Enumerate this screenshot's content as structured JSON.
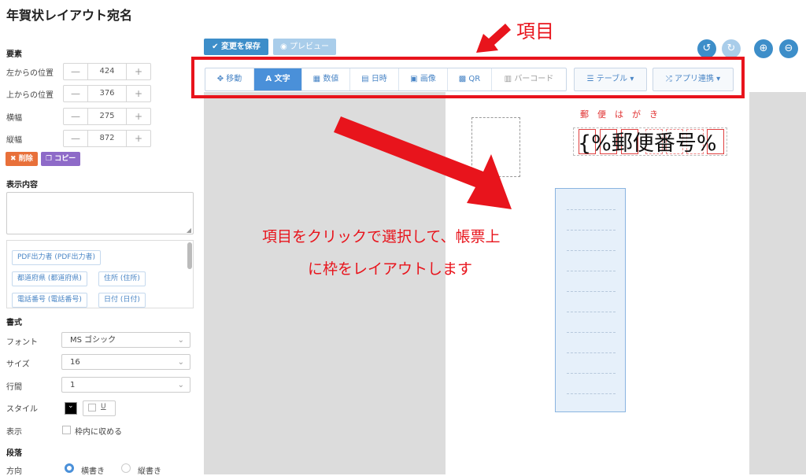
{
  "page": {
    "title": "年賀状レイアウト宛名"
  },
  "element_section": {
    "title": "要素",
    "fields": [
      {
        "label": "左からの位置",
        "value": "424"
      },
      {
        "label": "上からの位置",
        "value": "376"
      },
      {
        "label": "横幅",
        "value": "275"
      },
      {
        "label": "縦幅",
        "value": "872"
      }
    ],
    "minus": "—",
    "plus": "+",
    "delete_label": "削除",
    "copy_label": "コピー"
  },
  "content_section": {
    "title": "表示内容",
    "chips": [
      "PDF出力者 (PDF出力者)",
      "都道府県 (都道府県)",
      "住所 (住所)",
      "電話番号 (電話番号)",
      "日付 (日付)"
    ]
  },
  "format_section": {
    "title": "書式",
    "font_label": "フォント",
    "font_value": "MS ゴシック",
    "size_label": "サイズ",
    "size_value": "16",
    "line_label": "行間",
    "line_value": "1",
    "style_label": "スタイル",
    "underline_label": "U",
    "display_label": "表示",
    "fit_label": "枠内に収める"
  },
  "paragraph_section": {
    "title": "段落",
    "direction_label": "方向",
    "horizontal_label": "横書き",
    "vertical_label": "縦書き"
  },
  "top_buttons": {
    "save_label": "変更を保存",
    "preview_label": "プレビュー"
  },
  "toolbar": {
    "items": [
      {
        "label": "移動",
        "icon": "move-icon"
      },
      {
        "label": "文字",
        "icon": "text-icon"
      },
      {
        "label": "数値",
        "icon": "calculator-icon"
      },
      {
        "label": "日時",
        "icon": "calendar-icon"
      },
      {
        "label": "画像",
        "icon": "image-icon"
      },
      {
        "label": "QR",
        "icon": "qr-icon"
      },
      {
        "label": "バーコード",
        "icon": "barcode-icon"
      }
    ],
    "table_label": "テーブル",
    "app_link_label": "アプリ連携"
  },
  "canvas": {
    "postcard_label": "郵便はがき",
    "zip_text": "{%郵便番号%"
  },
  "annotations": {
    "title": "項目",
    "line1": "項目をクリックで選択して、帳票上",
    "line2": "に枠をレイアウトします"
  },
  "colors": {
    "accent": "#4a90d9",
    "annotation_red": "#e8141c",
    "delete": "#e8703a",
    "copy": "#8e6ac8"
  }
}
